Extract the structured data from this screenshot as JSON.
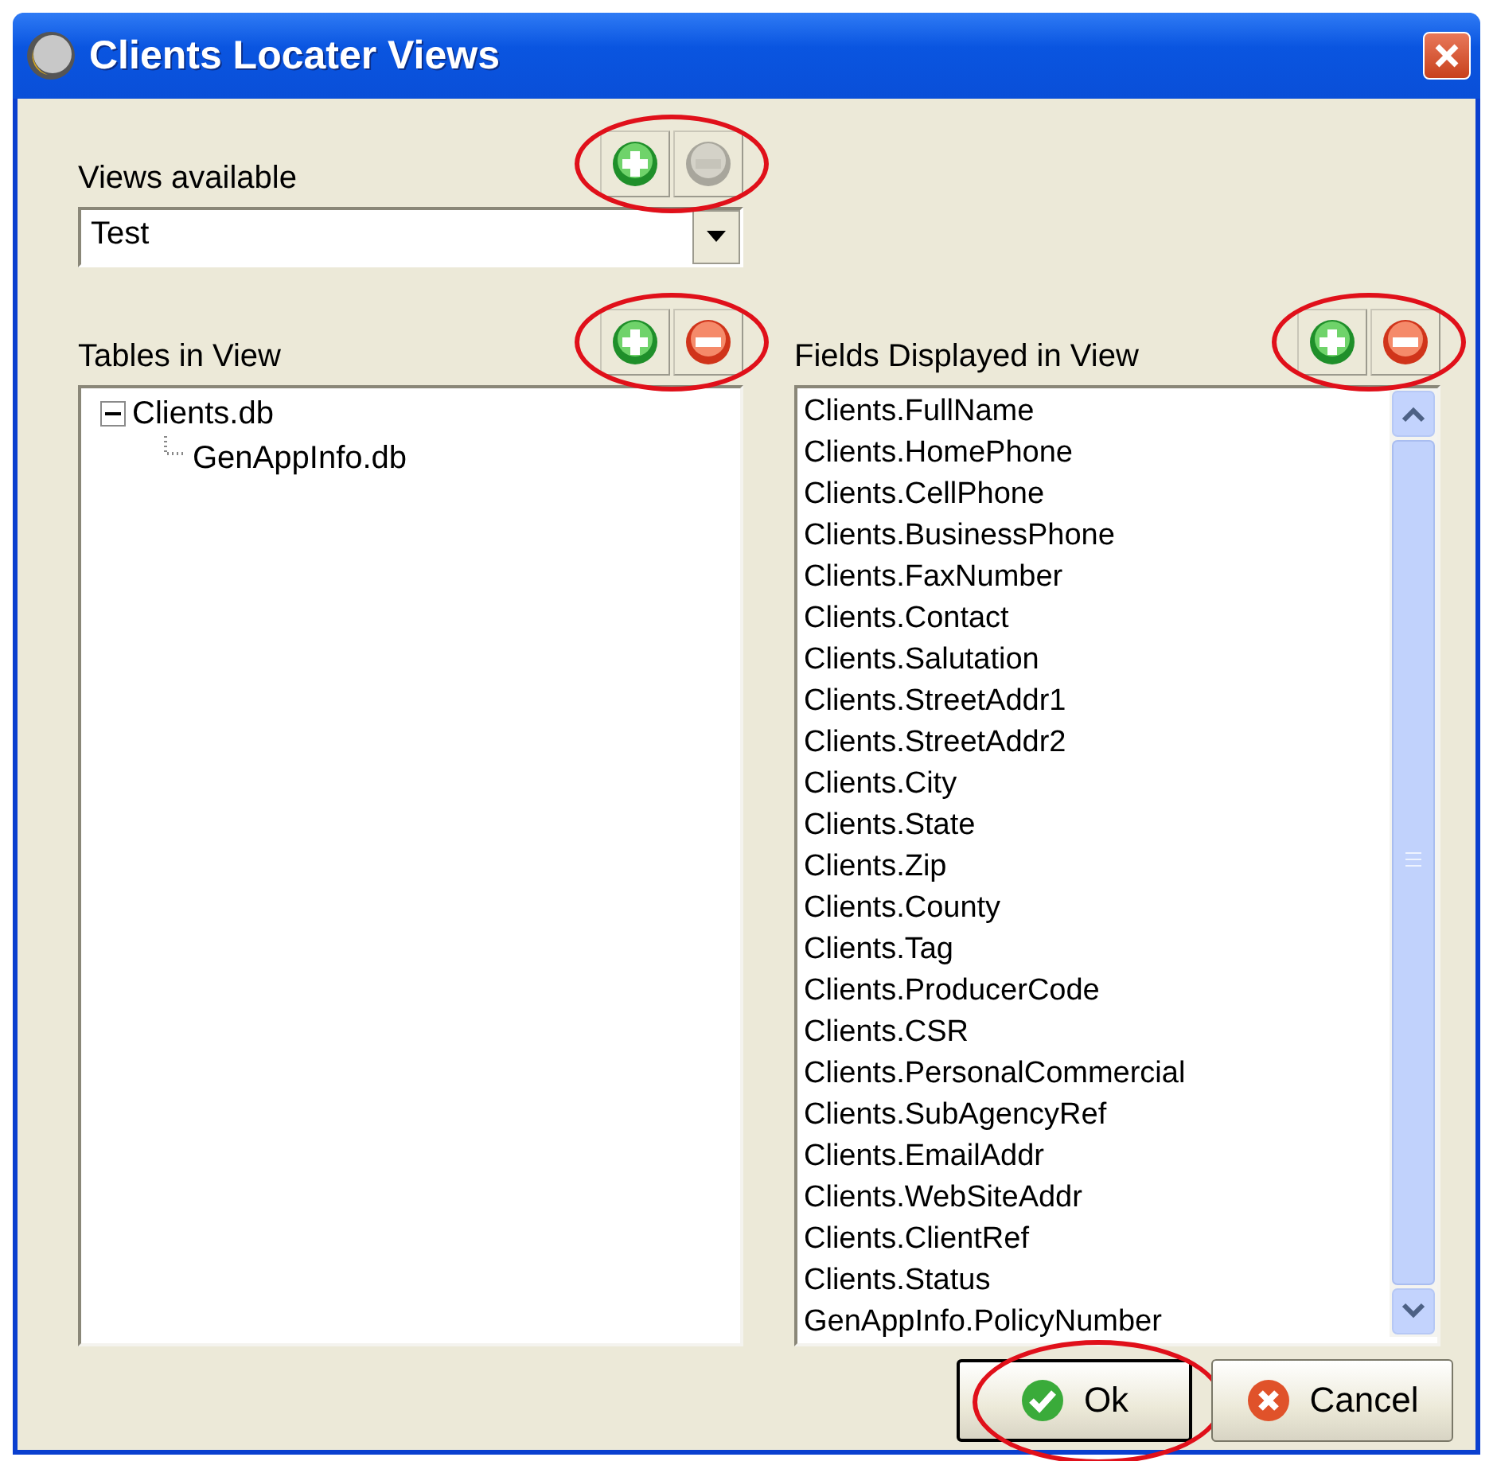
{
  "window": {
    "title": "Clients Locater Views"
  },
  "views": {
    "label": "Views available",
    "value": "Test",
    "toolbar": {
      "circled": true,
      "buttons": [
        {
          "kind": "add",
          "disabled": false
        },
        {
          "kind": "remove",
          "disabled": true
        }
      ]
    }
  },
  "tables": {
    "label": "Tables in View",
    "toolbar": {
      "circled": true,
      "buttons": [
        {
          "kind": "add",
          "disabled": false
        },
        {
          "kind": "remove",
          "disabled": false
        }
      ]
    },
    "tree": [
      {
        "label": "Clients.db",
        "expanded": true,
        "children": [
          {
            "label": "GenAppInfo.db"
          }
        ]
      }
    ]
  },
  "fields": {
    "label": "Fields Displayed in View",
    "toolbar": {
      "circled": true,
      "buttons": [
        {
          "kind": "add",
          "disabled": false
        },
        {
          "kind": "remove",
          "disabled": false
        }
      ]
    },
    "items": [
      "Clients.FullName",
      "Clients.HomePhone",
      "Clients.CellPhone",
      "Clients.BusinessPhone",
      "Clients.FaxNumber",
      "Clients.Contact",
      "Clients.Salutation",
      "Clients.StreetAddr1",
      "Clients.StreetAddr2",
      "Clients.City",
      "Clients.State",
      "Clients.Zip",
      "Clients.County",
      "Clients.Tag",
      "Clients.ProducerCode",
      "Clients.CSR",
      "Clients.PersonalCommercial",
      "Clients.SubAgencyRef",
      "Clients.EmailAddr",
      "Clients.WebSiteAddr",
      "Clients.ClientRef",
      "Clients.Status",
      "GenAppInfo.PolicyNumber"
    ]
  },
  "buttons": [
    {
      "kind": "ok",
      "label": "Ok",
      "circled": true
    },
    {
      "kind": "cancel",
      "label": "Cancel",
      "circled": false
    }
  ]
}
